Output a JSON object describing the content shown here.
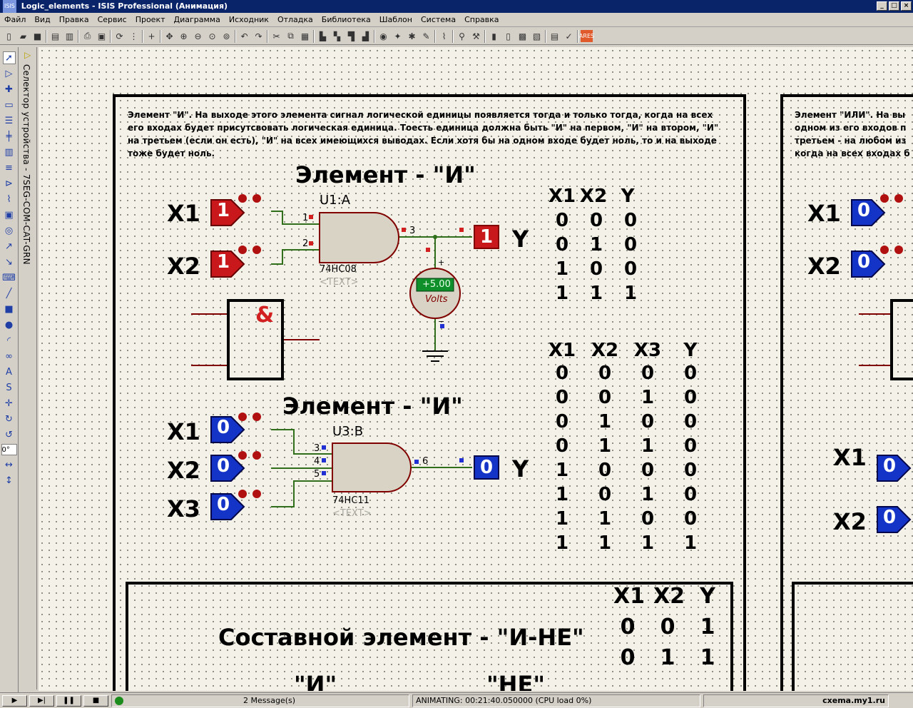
{
  "window": {
    "title": "Logic_elements - ISIS Professional (Анимация)",
    "logo_text": "ISIS"
  },
  "menu": [
    "Файл",
    "Вид",
    "Правка",
    "Сервис",
    "Проект",
    "Диаграмма",
    "Исходник",
    "Отладка",
    "Библиотека",
    "Шаблон",
    "Система",
    "Справка"
  ],
  "left_panel": {
    "rotation_value": "0°",
    "selector_label": "Селектор устройства - 7SEG-COM-CAT-GRN"
  },
  "schematic": {
    "and_desc": [
      "Элемент \"И\". На выходе этого элемента сигнал логической единицы появляется тогда и только тогда, когда на всех",
      "его входах будет присутсвовать логическая единица. Тоесть единица должна быть \"И\" на первом, \"И\" на втором, \"И\"",
      "на третьем (если он есть), \"И\" на всех имеющихся выводах. Если хотя бы на одном входе будет ноль, то и на выходе",
      "тоже будет ноль."
    ],
    "or_desc": [
      "Элемент \"ИЛИ\". На вы",
      "одном из его входов п",
      "третьем - на любом из",
      "когда на всех входах б"
    ],
    "title_and_1": "Элемент - \"И\"",
    "title_and_2": "Элемент - \"И\"",
    "title_nand": "Составной элемент - \"И-НЕ\"",
    "nand_sub_and": "\"И\"",
    "nand_sub_not": "\"НЕ\"",
    "gate1": {
      "ref": "U1:A",
      "part": "74HC08",
      "text": "<TEXT>",
      "pin1": "1",
      "pin2": "2",
      "pin3": "3"
    },
    "gate2": {
      "ref": "U3:B",
      "part": "74HC11",
      "text": "<TEXT>",
      "pin3": "3",
      "pin4": "4",
      "pin5": "5",
      "pin6": "6"
    },
    "voltmeter": {
      "value": "+5.00",
      "unit": "Volts",
      "plus": "+",
      "minus": "−"
    },
    "and_symbol": "&",
    "labels": {
      "x1": "X1",
      "x2": "X2",
      "x3": "X3",
      "y": "Y"
    },
    "states": {
      "in1_a": "1",
      "in2_a": "1",
      "out_a": "1",
      "in1_b": "0",
      "in2_b": "0",
      "in3_b": "0",
      "out_b": "0",
      "or_in1": "0",
      "or_in2": "0",
      "or_in3": "0",
      "or_in4": "0"
    },
    "truth2": {
      "headers": [
        "X1",
        "X2",
        "Y"
      ],
      "rows": [
        [
          "0",
          "0",
          "0"
        ],
        [
          "0",
          "1",
          "0"
        ],
        [
          "1",
          "0",
          "0"
        ],
        [
          "1",
          "1",
          "1"
        ]
      ]
    },
    "truth3": {
      "headers": [
        "X1",
        "X2",
        "X3",
        "Y"
      ],
      "rows": [
        [
          "0",
          "0",
          "0",
          "0"
        ],
        [
          "0",
          "0",
          "1",
          "0"
        ],
        [
          "0",
          "1",
          "0",
          "0"
        ],
        [
          "0",
          "1",
          "1",
          "0"
        ],
        [
          "1",
          "0",
          "0",
          "0"
        ],
        [
          "1",
          "0",
          "1",
          "0"
        ],
        [
          "1",
          "1",
          "0",
          "0"
        ],
        [
          "1",
          "1",
          "1",
          "1"
        ]
      ]
    },
    "truth_nand": {
      "headers": [
        "X1",
        "X2",
        "Y"
      ],
      "rows": [
        [
          "0",
          "0",
          "1"
        ],
        [
          "0",
          "1",
          "1"
        ]
      ]
    }
  },
  "status": {
    "messages": "2 Message(s)",
    "animating": "ANIMATING: 00:21:40.050000 (CPU load 0%)",
    "watermark": "cxema.my1.ru"
  }
}
